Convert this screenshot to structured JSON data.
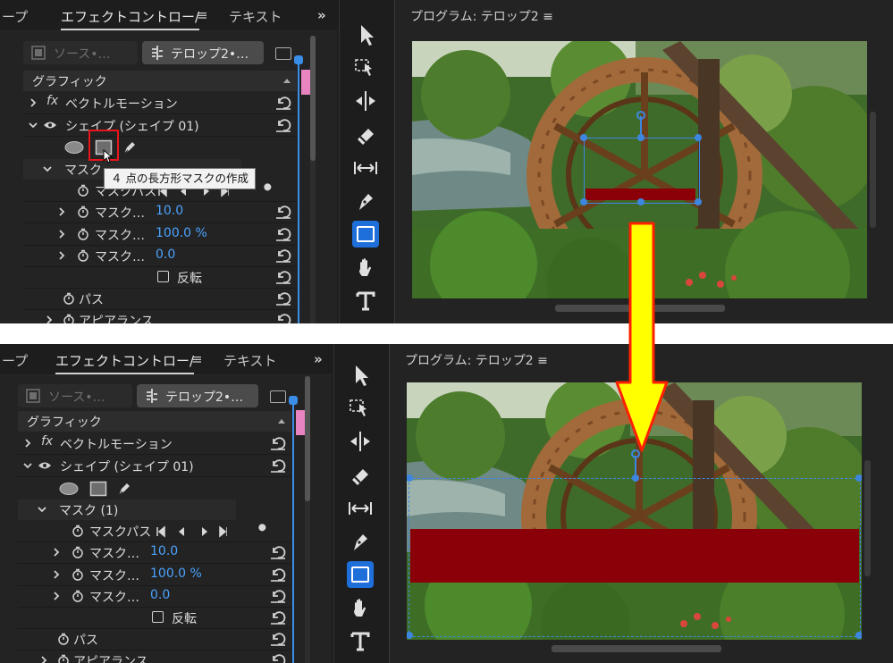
{
  "panel": {
    "tab_left": "ープ",
    "tab_effects": "エフェクトコントロー/",
    "tab_menu": "≡",
    "tab_text": "テキスト",
    "overflow": "»",
    "source_label": "ソース•…",
    "sequence_label": "テロップ2•…"
  },
  "effects": {
    "graphic": "グラフィック",
    "vector_motion": "ベクトルモーション",
    "shape": "シェイプ (シェイプ 01)",
    "mask_top": "マスク",
    "mask_bottom": "マスク (1)",
    "mask_path": "マスクパス",
    "mask_feather": "マスク…",
    "mask_feather_value": "10.0",
    "mask_opacity": "マスク…",
    "mask_opacity_value": "100.0 %",
    "mask_expansion": "マスク…",
    "mask_expansion_value": "0.0",
    "invert": "反転",
    "path": "パス",
    "appearance": "アピアランス",
    "fx_badge": "fx"
  },
  "tooltip": "４ 点の長方形マスクの作成",
  "program": {
    "title": "プログラム: テロップ2",
    "menu": "≡"
  },
  "colors": {
    "accent": "#1e6fd9",
    "mask_outline": "#3d86e0",
    "caption_bar": "#8b0008",
    "arrow_fill": "#ffff00",
    "arrow_stroke": "#ff2000",
    "highlight": "#e8161a"
  },
  "tools": [
    "selection-tool",
    "track-select-tool",
    "ripple-edit-tool",
    "razor-tool",
    "slip-tool",
    "pen-tool",
    "rectangle-tool",
    "hand-tool",
    "type-tool"
  ],
  "icons": [
    "ellipse-mask-icon",
    "rectangle-mask-icon",
    "pen-mask-icon",
    "stopwatch-icon",
    "reset-icon",
    "wrench-icon",
    "eye-icon"
  ]
}
